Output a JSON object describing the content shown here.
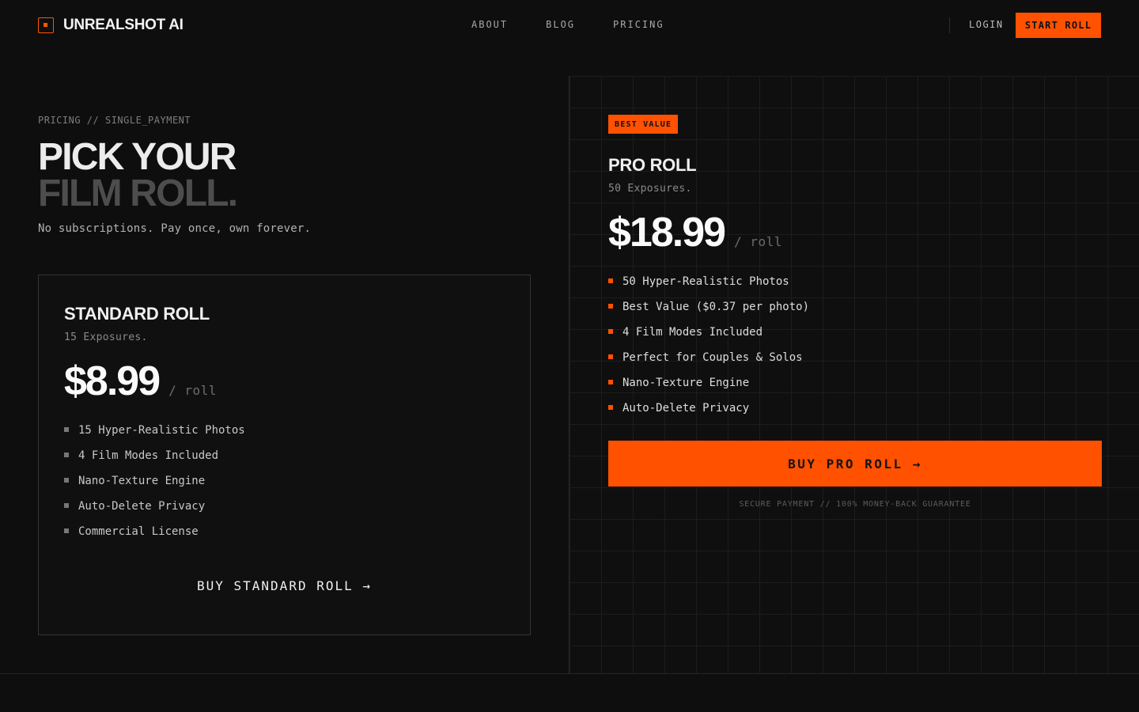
{
  "brand": {
    "name": "UNREALSHOT AI",
    "icon": "film-frame-icon",
    "accent": "#ff5100"
  },
  "nav": {
    "links": [
      {
        "label": "ABOUT"
      },
      {
        "label": "BLOG"
      },
      {
        "label": "PRICING"
      }
    ],
    "login": "LOGIN",
    "cta": "START ROLL"
  },
  "hero": {
    "eyebrow": "PRICING // SINGLE_PAYMENT",
    "title_line1": "PICK YOUR",
    "title_line2": "FILM ROLL.",
    "subtitle": "No subscriptions. Pay once, own forever."
  },
  "standard": {
    "title": "STANDARD ROLL",
    "subtitle": "15 Exposures.",
    "price": "$8.99",
    "per": "/ roll",
    "features": [
      "15 Hyper-Realistic Photos",
      "4 Film Modes Included",
      "Nano-Texture Engine",
      "Auto-Delete Privacy",
      "Commercial License"
    ],
    "cta": "BUY STANDARD ROLL →"
  },
  "pro": {
    "badge": "BEST VALUE",
    "title": "PRO ROLL",
    "subtitle": "50 Exposures.",
    "price": "$18.99",
    "per": "/ roll",
    "features": [
      "50 Hyper-Realistic Photos",
      "Best Value ($0.37 per photo)",
      "4 Film Modes Included",
      "Perfect for Couples & Solos",
      "Nano-Texture Engine",
      "Auto-Delete Privacy"
    ],
    "cta": "BUY PRO ROLL →",
    "footnote": "SECURE PAYMENT // 100% MONEY-BACK GUARANTEE"
  }
}
